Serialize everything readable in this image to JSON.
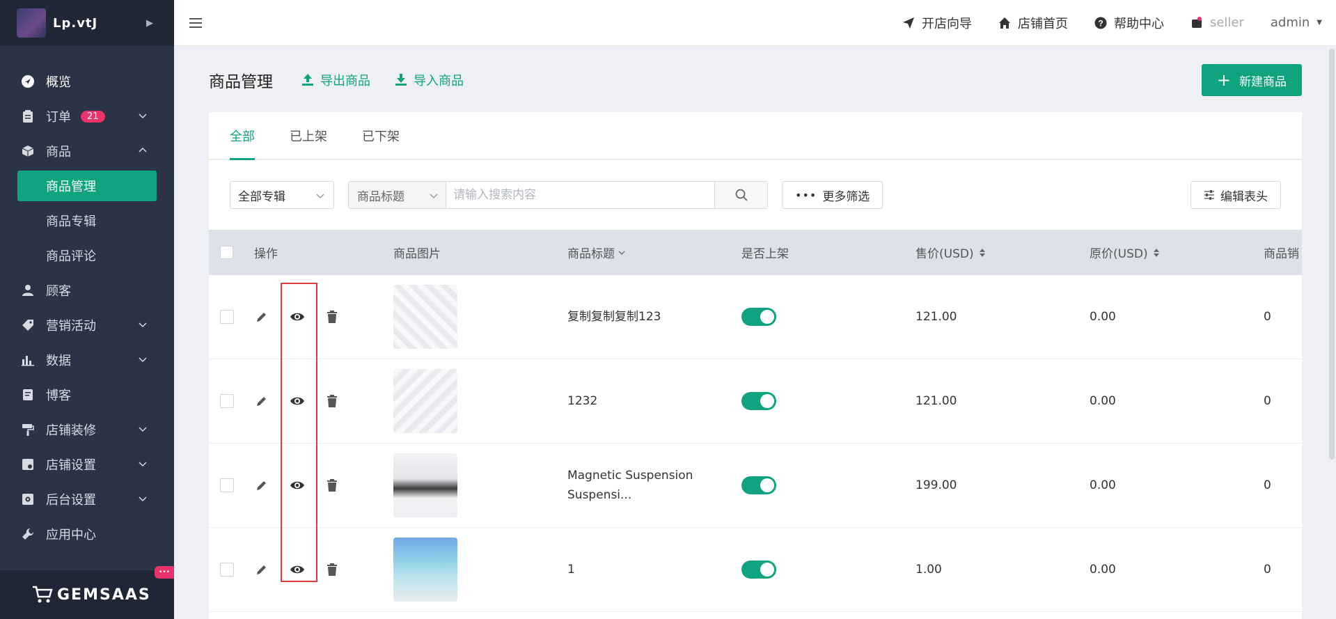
{
  "brand": {
    "name": "Lp.vtJ"
  },
  "sidebar": {
    "items": [
      {
        "label": "概览",
        "icon": "dashboard-icon"
      },
      {
        "label": "订单",
        "icon": "clipboard-icon",
        "badge": "21"
      },
      {
        "label": "商品",
        "icon": "box-icon"
      },
      {
        "label": "顾客",
        "icon": "user-icon"
      },
      {
        "label": "营销活动",
        "icon": "tag-icon"
      },
      {
        "label": "数据",
        "icon": "bar-chart-icon"
      },
      {
        "label": "博客",
        "icon": "document-icon"
      },
      {
        "label": "店铺装修",
        "icon": "paint-roller-icon"
      },
      {
        "label": "店铺设置",
        "icon": "store-icon"
      },
      {
        "label": "后台设置",
        "icon": "gear-icon"
      },
      {
        "label": "应用中心",
        "icon": "wrench-icon"
      }
    ],
    "sub_items": [
      "商品管理",
      "商品专辑",
      "商品评论"
    ],
    "footer_logo": "GEMSAAS"
  },
  "topbar": {
    "links": [
      "开店向导",
      "店铺首页",
      "帮助中心",
      "seller"
    ],
    "user": "admin"
  },
  "page": {
    "title": "商品管理",
    "export_label": "导出商品",
    "import_label": "导入商品",
    "new_label": "新建商品"
  },
  "tabs": [
    "全部",
    "已上架",
    "已下架"
  ],
  "filters": {
    "collection": "全部专辑",
    "search_type": "商品标题",
    "search_placeholder": "请输入搜索内容",
    "more_label": "更多筛选",
    "edit_header_label": "编辑表头"
  },
  "table": {
    "headers": {
      "actions": "操作",
      "image": "商品图片",
      "title": "商品标题",
      "on_sale": "是否上架",
      "price": "售价(USD)",
      "original_price": "原价(USD)",
      "sales": "商品销"
    },
    "rows": [
      {
        "title": "复制复制复制123",
        "on_sale": true,
        "price": "121.00",
        "original_price": "0.00",
        "sales": "0"
      },
      {
        "title": "1232",
        "on_sale": true,
        "price": "121.00",
        "original_price": "0.00",
        "sales": "0"
      },
      {
        "title": "Magnetic Suspension Suspensi...",
        "on_sale": true,
        "price": "199.00",
        "original_price": "0.00",
        "sales": "0"
      },
      {
        "title": "1",
        "on_sale": true,
        "price": "1.00",
        "original_price": "0.00",
        "sales": "0"
      }
    ]
  },
  "colors": {
    "accent": "#0fa37f",
    "sidebar": "#2b3446",
    "badge": "#e8336d",
    "highlight": "#e23b3b"
  }
}
